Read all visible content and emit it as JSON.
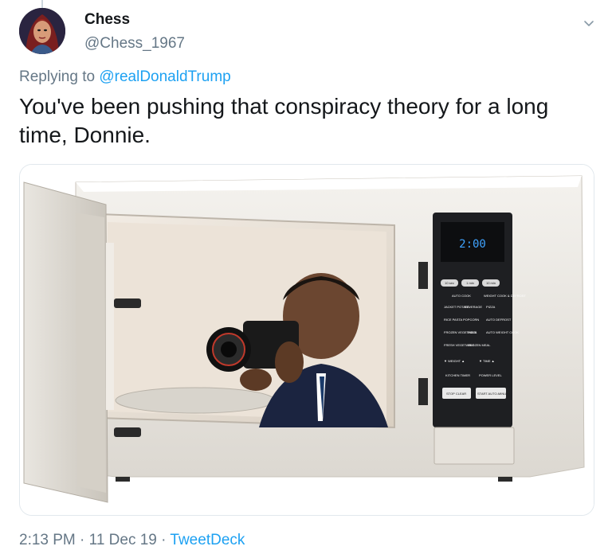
{
  "tweet": {
    "author": {
      "display_name": "Chess",
      "handle": "@Chess_1967"
    },
    "reply_prefix": "Replying to ",
    "reply_to": "@realDonaldTrump",
    "text": "You've been pushing that conspiracy theory for a long time, Donnie.",
    "time": "2:13 PM",
    "date": "11 Dec 19",
    "separator": " · ",
    "source": "TweetDeck"
  },
  "media": {
    "microwave_display": "2:00",
    "keypad": {
      "top_buttons": [
        "10 sec",
        "1 min",
        "10 min"
      ],
      "rows": [
        [
          "AUTO COOK",
          "WEIGHT COOK & DEFROST"
        ],
        [
          "JACKET POTATO",
          "BEVERAGE",
          "PIZZA"
        ],
        [
          "RICE PASTA",
          "POPCORN",
          "AUTO DEFROST"
        ],
        [
          "FROZEN VEGETABLE",
          "PIZZA",
          "AUTO WEIGHT COOK"
        ],
        [
          "FRESH VEGETABLE",
          "FROZEN MEAL"
        ],
        [
          "▼ WEIGHT ▲",
          "▼ TIME ▲"
        ],
        [
          "KITCHEN TIMER",
          "POWER LEVEL"
        ],
        [
          "STOP CLEAR",
          "START AUTO-MINUTE"
        ]
      ]
    }
  },
  "colors": {
    "link": "#1da1f2",
    "secondary_text": "#657786",
    "primary_text": "#14171a"
  }
}
